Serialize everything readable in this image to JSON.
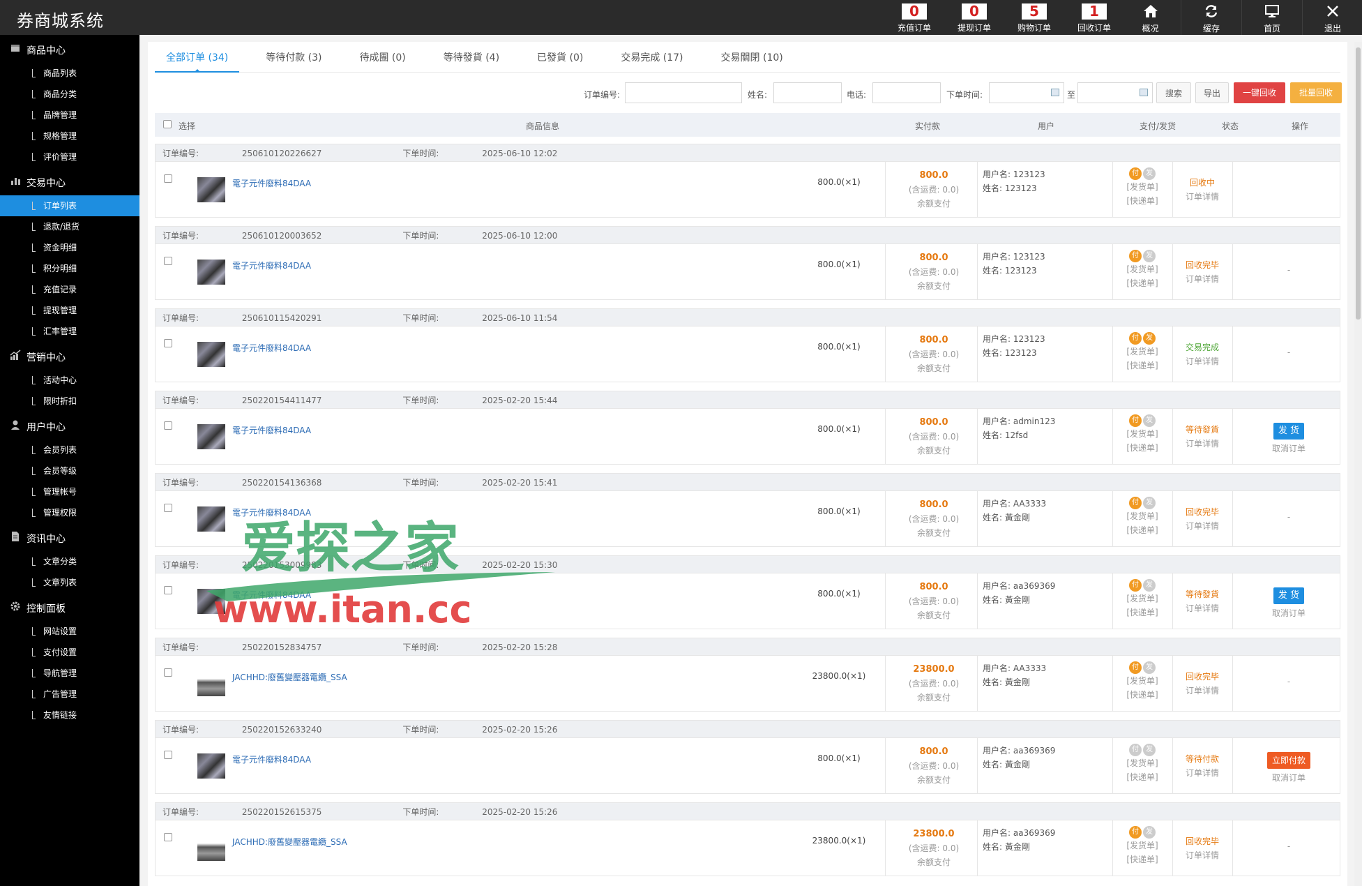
{
  "app": {
    "title": "券商城系统"
  },
  "counters": [
    {
      "num": "0",
      "label": "充值订单"
    },
    {
      "num": "0",
      "label": "提现订单"
    },
    {
      "num": "5",
      "label": "购物订单"
    },
    {
      "num": "1",
      "label": "回收订单"
    }
  ],
  "topnav": [
    {
      "label": "概况",
      "icon": "home-icon"
    },
    {
      "label": "缓存",
      "icon": "refresh-icon"
    },
    {
      "label": "首页",
      "icon": "monitor-icon"
    },
    {
      "label": "退出",
      "icon": "close-icon"
    }
  ],
  "sidebar": [
    {
      "title": "商品中心",
      "icon": "box-icon",
      "items": [
        "商品列表",
        "商品分类",
        "品牌管理",
        "规格管理",
        "评价管理"
      ]
    },
    {
      "title": "交易中心",
      "icon": "bar-chart-icon",
      "items": [
        "订单列表",
        "退款/退货",
        "资金明细",
        "积分明细",
        "充值记录",
        "提现管理",
        "汇率管理"
      ]
    },
    {
      "title": "营销中心",
      "icon": "growth-chart-icon",
      "items": [
        "活动中心",
        "限时折扣"
      ]
    },
    {
      "title": "用户中心",
      "icon": "user-icon",
      "items": [
        "会员列表",
        "会员等级",
        "管理帐号",
        "管理权限"
      ]
    },
    {
      "title": "资讯中心",
      "icon": "document-icon",
      "items": [
        "文章分类",
        "文章列表"
      ]
    },
    {
      "title": "控制面板",
      "icon": "gear-icon",
      "items": [
        "网站设置",
        "支付设置",
        "导航管理",
        "广告管理",
        "友情链接"
      ]
    }
  ],
  "tabs": [
    "全部订单 (34)",
    "等待付款 (3)",
    "待成團 (0)",
    "等待發貨 (4)",
    "已發貨 (0)",
    "交易完成 (17)",
    "交易關閉 (10)"
  ],
  "filters": {
    "order_no": "订单编号:",
    "name": "姓名:",
    "phone": "电话:",
    "time": "下单时间:",
    "to": "至",
    "search": "搜索",
    "export": "导出",
    "recycle_one": "一键回收",
    "recycle_batch": "批量回收"
  },
  "table_headers": [
    "选择",
    "商品信息",
    "实付款",
    "用户",
    "支付/发货",
    "状态",
    "操作"
  ],
  "labels": {
    "order_no": "订单编号:",
    "order_time": "下单时间:",
    "freight": "(含运费: 0.0)",
    "balance": "余额支付",
    "username": "用户名:",
    "name": "姓名:",
    "pay_short": "付",
    "ship_short": "发",
    "ship_bill": "[发货单]",
    "express_bill": "[快递单]",
    "detail": "订单详情",
    "ship_btn": "发 货",
    "cancel": "取消订单",
    "pay_now": "立即付款"
  },
  "orders": [
    {
      "no": "250610120226627",
      "time": "2025-06-10 12:02",
      "product": "電子元件廢料84DAA",
      "qty": "800.0(×1)",
      "amount": "800.0",
      "user": "123123",
      "name": "123123",
      "pay": true,
      "ship": false,
      "status": "回收中",
      "status_color": "#e57a12",
      "op": ""
    },
    {
      "no": "250610120003652",
      "time": "2025-06-10 12:00",
      "product": "電子元件廢料84DAA",
      "qty": "800.0(×1)",
      "amount": "800.0",
      "user": "123123",
      "name": "123123",
      "pay": true,
      "ship": false,
      "status": "回收完毕",
      "status_color": "#e57a12",
      "op": "-"
    },
    {
      "no": "250610115420291",
      "time": "2025-06-10 11:54",
      "product": "電子元件廢料84DAA",
      "qty": "800.0(×1)",
      "amount": "800.0",
      "user": "123123",
      "name": "123123",
      "pay": true,
      "ship": true,
      "status": "交易完成",
      "status_color": "#52a83a",
      "op": "-"
    },
    {
      "no": "250220154411477",
      "time": "2025-02-20 15:44",
      "product": "電子元件廢料84DAA",
      "qty": "800.0(×1)",
      "amount": "800.0",
      "user": "admin123",
      "name": "12fsd",
      "pay": true,
      "ship": false,
      "status": "等待發貨",
      "status_color": "#e57a12",
      "op": "ship"
    },
    {
      "no": "250220154136368",
      "time": "2025-02-20 15:41",
      "product": "電子元件廢料84DAA",
      "qty": "800.0(×1)",
      "amount": "800.0",
      "user": "AA3333",
      "name": "黃金剛",
      "pay": true,
      "ship": false,
      "status": "回收完毕",
      "status_color": "#e57a12",
      "op": "-"
    },
    {
      "no": "250220153009983",
      "time": "2025-02-20 15:30",
      "product": "電子元件廢料84DAA",
      "qty": "800.0(×1)",
      "amount": "800.0",
      "user": "aa369369",
      "name": "黃金剛",
      "pay": true,
      "ship": false,
      "status": "等待發貨",
      "status_color": "#e57a12",
      "op": "ship"
    },
    {
      "no": "250220152834757",
      "time": "2025-02-20 15:28",
      "product": "JACHHD:廢舊變壓器電纜_SSA",
      "qty": "23800.0(×1)",
      "amount": "23800.0",
      "user": "AA3333",
      "name": "黃金剛",
      "pay": true,
      "ship": false,
      "status": "回收完毕",
      "status_color": "#e57a12",
      "op": "-"
    },
    {
      "no": "250220152633240",
      "time": "2025-02-20 15:26",
      "product": "電子元件廢料84DAA",
      "qty": "800.0(×1)",
      "amount": "800.0",
      "user": "aa369369",
      "name": "黃金剛",
      "pay": false,
      "ship": false,
      "status": "等待付款",
      "status_color": "#e57a12",
      "op": "pay"
    },
    {
      "no": "250220152615375",
      "time": "2025-02-20 15:26",
      "product": "JACHHD:廢舊變壓器電纜_SSA",
      "qty": "23800.0(×1)",
      "amount": "23800.0",
      "user": "aa369369",
      "name": "黃金剛",
      "pay": true,
      "ship": false,
      "status": "回收完毕",
      "status_color": "#e57a12",
      "op": "-"
    }
  ],
  "watermark": {
    "line1": "爱探之家",
    "line2": "www.itan.cc"
  }
}
